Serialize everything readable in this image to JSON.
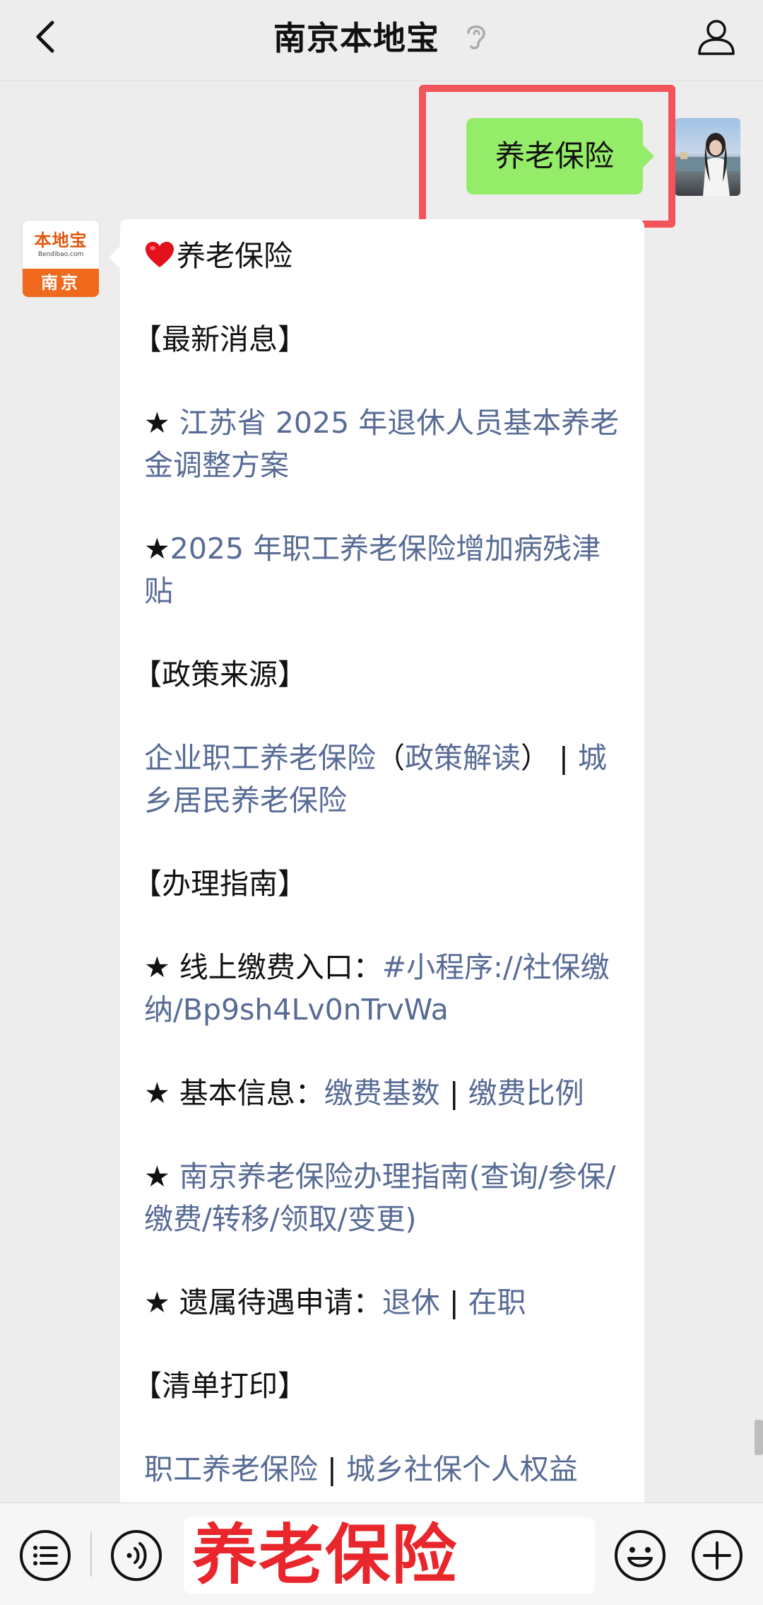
{
  "header": {
    "title": "南京本地宝",
    "back_icon": "chevron-left-icon",
    "ear_icon": "ear-icon",
    "profile_icon": "person-icon"
  },
  "user_message": {
    "text": "养老保险",
    "bubble_color": "#95ec69",
    "highlight_color": "#f2545b"
  },
  "bot_avatar": {
    "logo_name": "本地宝",
    "logo_url": "Bendibao.com",
    "city": "南京"
  },
  "reply": {
    "title": "养老保险",
    "latest_heading": "【最新消息】",
    "latest_items": [
      {
        "prefix": "★ ",
        "link": "江苏省 2025 年退休人员基本养老金调整方案"
      },
      {
        "prefix": "★",
        "link": "2025 年职工养老保险增加病残津贴"
      }
    ],
    "policy_heading": "【政策来源】",
    "policy": {
      "link1": "企业职工养老保险",
      "paren_open": "（",
      "link2": "政策解读",
      "paren_close": "）",
      "sep": " | ",
      "link3": "城乡居民养老保险"
    },
    "guide_heading": "【办理指南】",
    "guide": {
      "online_prefix": "★ 线上缴费入口：",
      "online_link": "#小程序://社保缴纳/Bp9sh4Lv0nTrvWa",
      "basic_prefix": "★ 基本信息：",
      "basic_link1": "缴费基数",
      "sep": " | ",
      "basic_link2": "缴费比例",
      "nanjing_prefix": "★ ",
      "nanjing_link": "南京养老保险办理指南(查询/参保/缴费/转移/领取/变更)",
      "survivor_prefix": "★ 遗属待遇申请：",
      "survivor_link1": "退休",
      "survivor_link2": "在职"
    },
    "print_heading": "【清单打印】",
    "print": {
      "link1": "职工养老保险",
      "sep": " | ",
      "link2": "城乡社保个人权益"
    },
    "link_color": "#576b95"
  },
  "input_bar": {
    "text": "养老保险",
    "text_color": "#e8262b",
    "menu_icon": "list-menu-icon",
    "voice_icon": "voice-icon",
    "emoji_icon": "emoji-icon",
    "plus_icon": "plus-icon"
  }
}
